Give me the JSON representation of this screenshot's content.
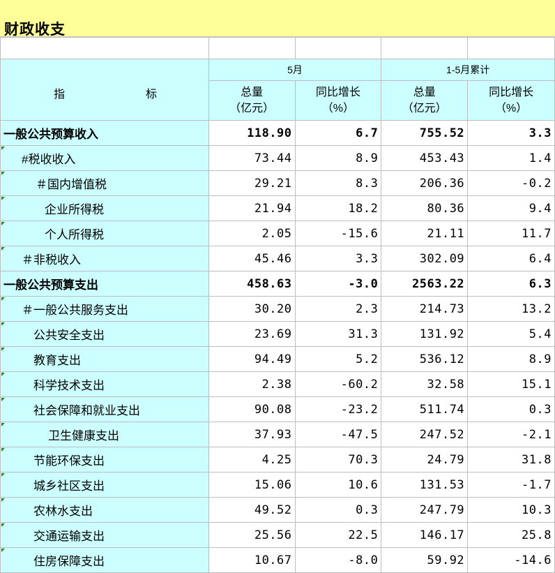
{
  "title": "财政收支",
  "header": {
    "indicator_left": "指",
    "indicator_right": "标",
    "period_month": "5月",
    "period_cumulative": "1-5月累计",
    "total_label": "总量",
    "total_unit": "（亿元）",
    "growth_label": "同比增长",
    "growth_unit": "（%）"
  },
  "rows": [
    {
      "label": "一般公共预算收入",
      "m_total": "118.90",
      "m_growth": "6.7",
      "c_total": "755.52",
      "c_growth": "3.3"
    },
    {
      "label": "#税收收入",
      "m_total": "73.44",
      "m_growth": "8.9",
      "c_total": "453.43",
      "c_growth": "1.4"
    },
    {
      "label": "＃国内增值税",
      "m_total": "29.21",
      "m_growth": "8.3",
      "c_total": "206.36",
      "c_growth": "-0.2"
    },
    {
      "label": "企业所得税",
      "m_total": "21.94",
      "m_growth": "18.2",
      "c_total": "80.36",
      "c_growth": "9.4"
    },
    {
      "label": "个人所得税",
      "m_total": "2.05",
      "m_growth": "-15.6",
      "c_total": "21.11",
      "c_growth": "11.7"
    },
    {
      "label": "＃非税收入",
      "m_total": "45.46",
      "m_growth": "3.3",
      "c_total": "302.09",
      "c_growth": "6.4"
    },
    {
      "label": "一般公共预算支出",
      "m_total": "458.63",
      "m_growth": "-3.0",
      "c_total": "2563.22",
      "c_growth": "6.3"
    },
    {
      "label": "＃一般公共服务支出",
      "m_total": "30.20",
      "m_growth": "2.3",
      "c_total": "214.73",
      "c_growth": "13.2"
    },
    {
      "label": "公共安全支出",
      "m_total": "23.69",
      "m_growth": "31.3",
      "c_total": "131.92",
      "c_growth": "5.4"
    },
    {
      "label": "教育支出",
      "m_total": "94.49",
      "m_growth": "5.2",
      "c_total": "536.12",
      "c_growth": "8.9"
    },
    {
      "label": "科学技术支出",
      "m_total": "2.38",
      "m_growth": "-60.2",
      "c_total": "32.58",
      "c_growth": "15.1"
    },
    {
      "label": "社会保障和就业支出",
      "m_total": "90.08",
      "m_growth": "-23.2",
      "c_total": "511.74",
      "c_growth": "0.3"
    },
    {
      "label": "卫生健康支出",
      "m_total": "37.93",
      "m_growth": "-47.5",
      "c_total": "247.52",
      "c_growth": "-2.1"
    },
    {
      "label": "节能环保支出",
      "m_total": "4.25",
      "m_growth": "70.3",
      "c_total": "24.79",
      "c_growth": "31.8"
    },
    {
      "label": "城乡社区支出",
      "m_total": "15.06",
      "m_growth": "10.6",
      "c_total": "131.53",
      "c_growth": "-1.7"
    },
    {
      "label": "农林水支出",
      "m_total": "49.52",
      "m_growth": "0.3",
      "c_total": "247.79",
      "c_growth": "10.3"
    },
    {
      "label": "交通运输支出",
      "m_total": "25.56",
      "m_growth": "22.5",
      "c_total": "146.17",
      "c_growth": "25.8"
    },
    {
      "label": "住房保障支出",
      "m_total": "10.67",
      "m_growth": "-8.0",
      "c_total": "59.92",
      "c_growth": "-14.6"
    }
  ]
}
